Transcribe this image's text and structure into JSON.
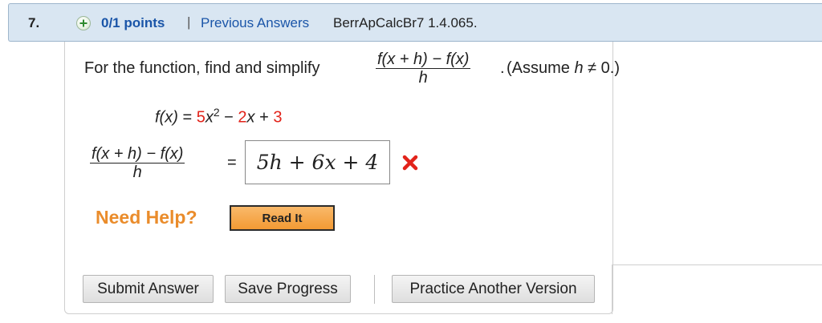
{
  "header": {
    "question_number": "7.",
    "points_label": "0/1 points",
    "separator": "|",
    "previous_answers_link": "Previous Answers",
    "question_id": "BerrApCalcBr7 1.4.065."
  },
  "prompt": {
    "text": "For the function, find and simplify",
    "fraction_numerator": "f(x + h) − f(x)",
    "fraction_denominator": "h",
    "period": ".",
    "assume_open": "(Assume ",
    "assume_var": "h",
    "assume_close": " ≠ 0.)"
  },
  "function": {
    "lhs": "f(x)",
    "equals": " = ",
    "coef1": "5",
    "x_squared": "x",
    "exponent": "2",
    "minus": " − ",
    "coef2": "2",
    "x": "x",
    "plus": " + ",
    "const": "3"
  },
  "answer": {
    "fraction_numerator": "f(x + h) − f(x)",
    "fraction_denominator": "h",
    "equals": "=",
    "value": "5h + 6x + 4",
    "status": "incorrect",
    "status_color": "#e2231a"
  },
  "help": {
    "label": "Need Help?",
    "read_it": "Read It"
  },
  "buttons": {
    "submit": "Submit Answer",
    "save": "Save Progress",
    "practice": "Practice Another Version"
  },
  "colors": {
    "link": "#1a55a8",
    "highlight_red": "#e2231a",
    "help_orange": "#ea8c2b",
    "header_bg": "#d9e6f2"
  }
}
